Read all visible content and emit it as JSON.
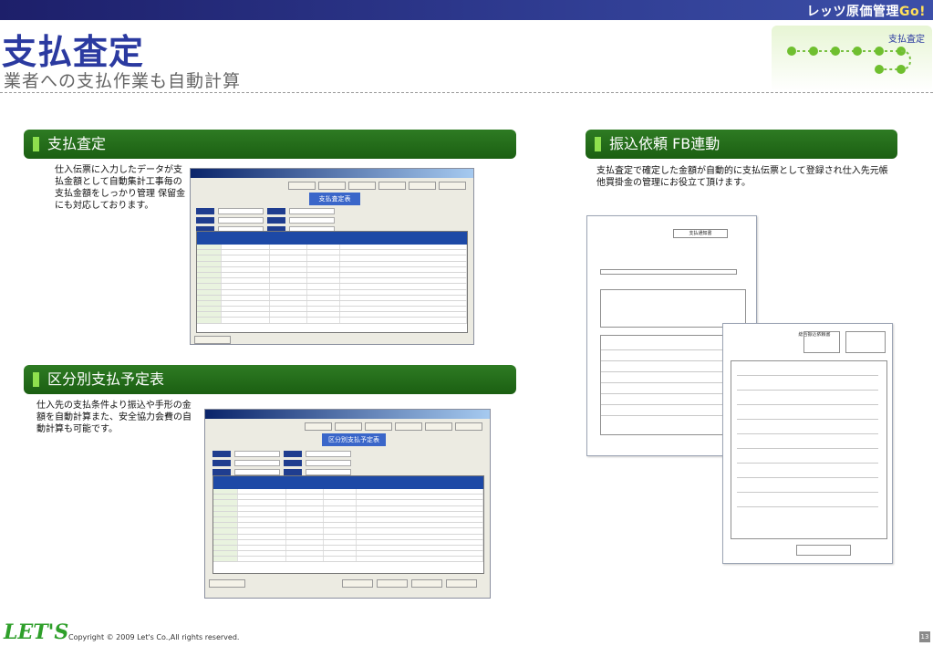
{
  "header": {
    "brand_prefix": "レッツ原価管理",
    "brand_suffix": "Go!",
    "title": "支払査定",
    "subtitle": "業者への支払作業も自動計算",
    "tag": "支払査定"
  },
  "sections": {
    "payment_assessment": {
      "heading": "支払査定",
      "description": "仕入伝票に入力したデータが支払金額として自動集計工事毎の支払金額をしっかり管理 保留金にも対応しております。",
      "window_caption": "支払査定表"
    },
    "fb_transfer": {
      "heading": "振込依頼 FB連動",
      "description": "支払査定で確定した金額が自動的に支払伝票として登録され仕入先元帳他買掛金の管理にお役立て頂けます。",
      "doc1_title": "支払通知書",
      "doc2_title": "総合振込依頼書"
    },
    "schedule_by_category": {
      "heading": "区分別支払予定表",
      "description": "仕入先の支払条件より振込や手形の金額を自動計算また、安全協力会費の自動計算も可能です。",
      "window_caption": "区分別支払予定表"
    }
  },
  "footer": {
    "logo": "LET'S",
    "copyright": "Copyright © 2009 Let's Co.,All rights reserved.",
    "page_number": "13"
  },
  "colors": {
    "accent_blue": "#2b3aa0",
    "section_green": "#1b5f12",
    "logo_green": "#2e9f2a"
  }
}
